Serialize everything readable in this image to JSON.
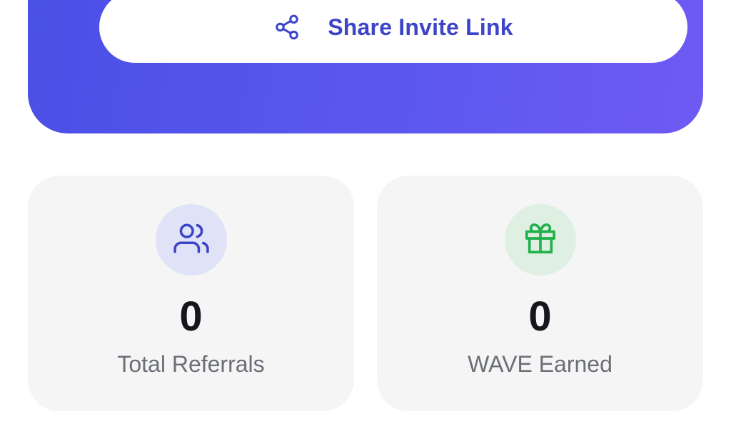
{
  "share": {
    "label": "Share Invite Link",
    "icon": "share-icon",
    "color": "#3c44c8"
  },
  "hero": {
    "gradient_start": "#4a4fe6",
    "gradient_end": "#6e5af3"
  },
  "stats": [
    {
      "value": "0",
      "label": "Total Referrals",
      "icon": "users-icon",
      "icon_color": "#3c44c8",
      "badge_color": "#e0e2f7"
    },
    {
      "value": "0",
      "label": "WAVE Earned",
      "icon": "gift-icon",
      "icon_color": "#22b04b",
      "badge_color": "#dff0e3"
    }
  ]
}
